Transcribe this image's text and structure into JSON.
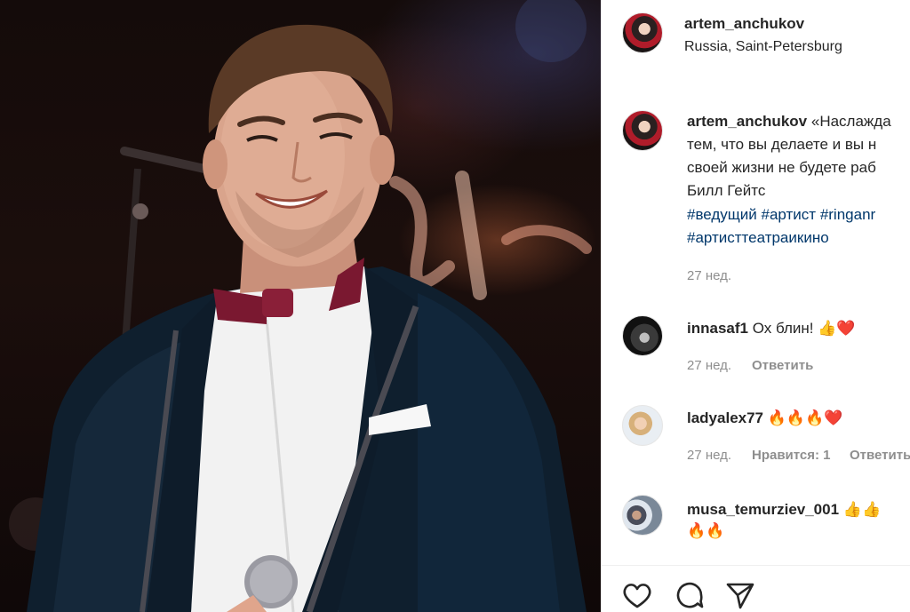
{
  "header": {
    "username": "artem_anchukov",
    "location": "Russia, Saint-Petersburg"
  },
  "caption": {
    "username": "artem_anchukov",
    "line1": "«Наслажда",
    "line2": "тем, что вы делаете и вы н",
    "line3": "своей жизни не будете раб",
    "line4": "Билл Гейтс",
    "hashtags_line1": [
      "#ведущий",
      "#артист",
      "#ringanr"
    ],
    "hashtags_line2": [
      "#артисттеатраикино"
    ],
    "time": "27 нед."
  },
  "comments": [
    {
      "username": "innasaf1",
      "text": "Ох блин!",
      "emojis": "👍❤️",
      "time": "27 нед.",
      "likes": "",
      "reply": "Ответить"
    },
    {
      "username": "ladyalex77",
      "text": "",
      "emojis": "🔥🔥🔥❤️",
      "time": "27 нед.",
      "likes": "Нравится: 1",
      "reply": "Ответить"
    },
    {
      "username": "musa_temurziev_001",
      "text": "",
      "emojis": "👍👍",
      "emojis_line2": "🔥🔥"
    }
  ],
  "actions": {
    "like": "heart-icon",
    "comment": "comment-icon",
    "share": "share-icon"
  },
  "colors": {
    "hashtag": "#00376b",
    "meta": "#8e8e8e",
    "text": "#262626"
  }
}
